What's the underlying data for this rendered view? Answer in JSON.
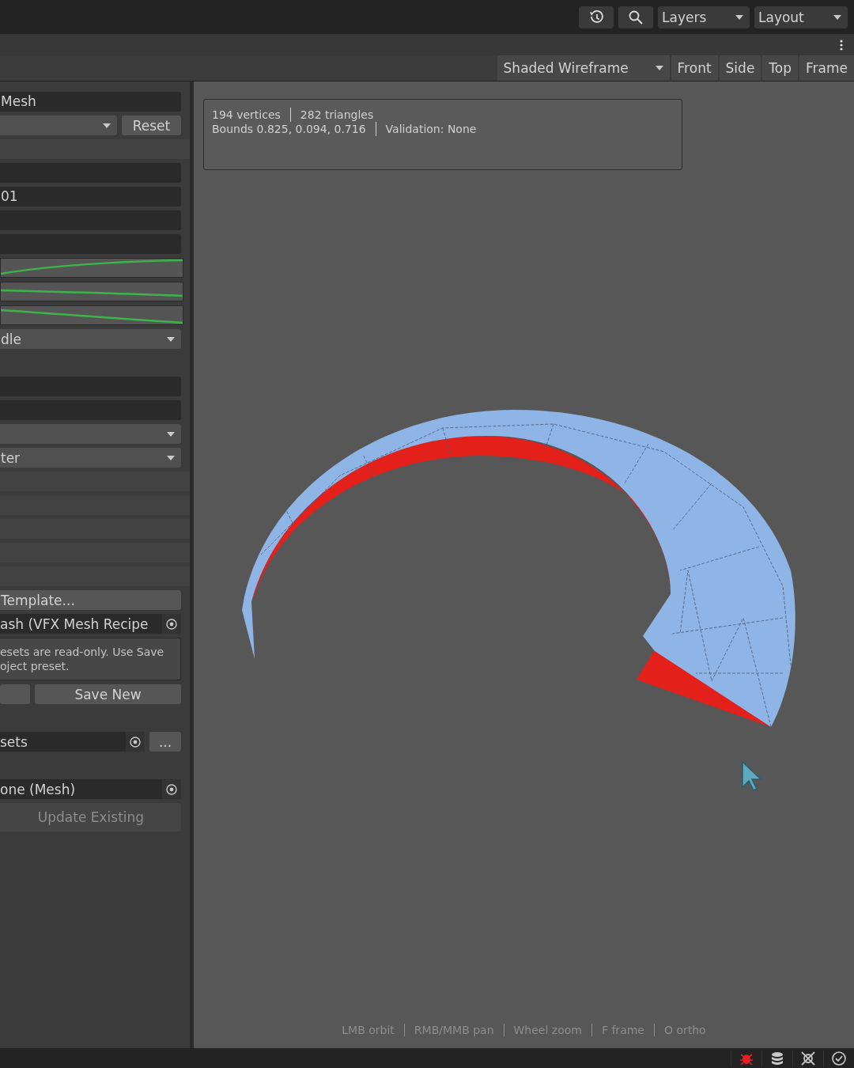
{
  "top_bar": {
    "buttons": [
      {
        "kind": "history"
      },
      {
        "kind": "search"
      }
    ],
    "dropdowns": [
      {
        "label": "Layers"
      },
      {
        "label": "Layout"
      }
    ]
  },
  "view_toolbar": {
    "shading": "Shaded Wireframe",
    "buttons": [
      "Front",
      "Side",
      "Top",
      "Frame"
    ]
  },
  "inspector": {
    "groups": [
      {
        "rows": [
          {
            "kind": "field",
            "value": "Mesh"
          },
          {
            "kind": "dropdown_button",
            "button": "Reset"
          },
          {
            "kind": "band"
          },
          {
            "kind": "field"
          },
          {
            "kind": "field",
            "value": "01"
          },
          {
            "kind": "field"
          },
          {
            "kind": "field"
          },
          {
            "kind": "curve"
          },
          {
            "kind": "curve"
          },
          {
            "kind": "curve"
          },
          {
            "kind": "dropdown",
            "value": "dle"
          }
        ]
      },
      {
        "rows": [
          {
            "kind": "field"
          },
          {
            "kind": "field"
          },
          {
            "kind": "dropdown"
          },
          {
            "kind": "dropdown",
            "value": "ter"
          },
          {
            "kind": "band"
          },
          {
            "kind": "band"
          },
          {
            "kind": "band"
          },
          {
            "kind": "band"
          },
          {
            "kind": "band"
          },
          {
            "kind": "button",
            "label": "Template...",
            "disabled": false
          },
          {
            "kind": "object",
            "value": "ash (VFX Mesh Recipe"
          },
          {
            "kind": "help",
            "text": "esets are read-only. Use Save\noject preset."
          },
          {
            "kind": "button_pair",
            "label": "Save New"
          }
        ]
      },
      {
        "rows": [
          {
            "kind": "object_more",
            "value": "sets",
            "button": "..."
          }
        ]
      },
      {
        "rows": [
          {
            "kind": "object",
            "value": "one (Mesh)"
          },
          {
            "kind": "button",
            "label": "Update Existing",
            "disabled": true
          }
        ]
      }
    ]
  },
  "viewport": {
    "stats": [
      "194 vertices",
      "282 triangles"
    ],
    "details": [
      "Bounds 0.825, 0.094, 0.716",
      "Validation: None"
    ],
    "hints": [
      "LMB orbit",
      "RMB/MMB pan",
      "Wheel zoom",
      "F frame",
      "O ortho"
    ]
  },
  "status_bar": {
    "icons": [
      {
        "kind": "bug",
        "alert": true
      },
      {
        "kind": "database",
        "alert": false
      },
      {
        "kind": "network",
        "alert": false
      },
      {
        "kind": "check",
        "alert": false
      }
    ]
  }
}
